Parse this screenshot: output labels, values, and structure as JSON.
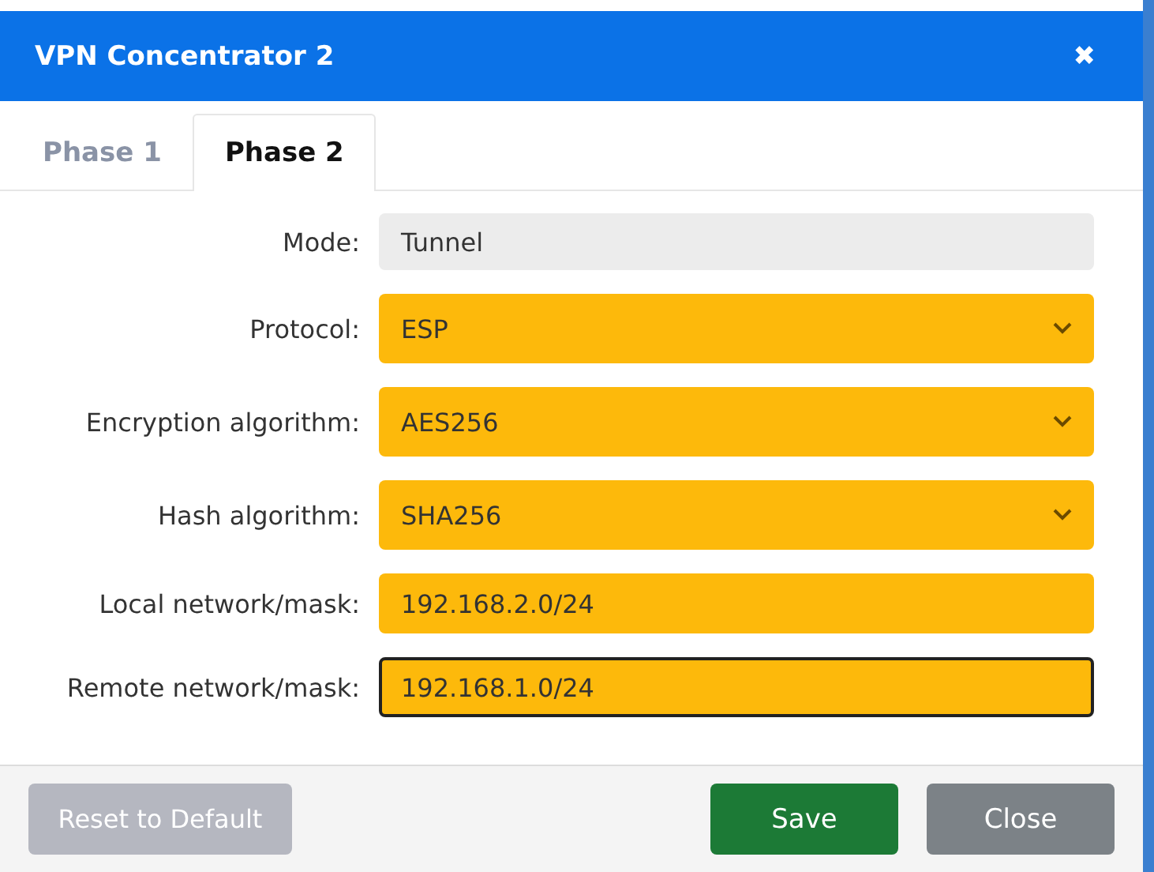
{
  "window": {
    "title": "VPN Concentrator 2",
    "close": "✖"
  },
  "tabs": [
    {
      "label": "Phase 1",
      "selected": false
    },
    {
      "label": "Phase 2",
      "selected": true
    }
  ],
  "fields": [
    {
      "label": "Mode:",
      "kind": "static",
      "value": "Tunnel",
      "focused": false
    },
    {
      "label": "Protocol:",
      "kind": "select",
      "value": "ESP",
      "focused": false
    },
    {
      "label": "Encryption algorithm:",
      "kind": "select",
      "value": "AES256",
      "focused": false
    },
    {
      "label": "Hash algorithm:",
      "kind": "select",
      "value": "SHA256",
      "focused": false
    },
    {
      "label": "Local network/mask:",
      "kind": "input",
      "value": "192.168.2.0/24",
      "focused": false
    },
    {
      "label": "Remote network/mask:",
      "kind": "input",
      "value": "192.168.1.0/24",
      "focused": true
    }
  ],
  "buttons": [
    {
      "label": "Reset to Default",
      "kind": "reset",
      "disabled": true
    },
    {
      "label": "Save",
      "kind": "save",
      "disabled": false
    },
    {
      "label": "Close",
      "kind": "close",
      "disabled": false
    }
  ]
}
